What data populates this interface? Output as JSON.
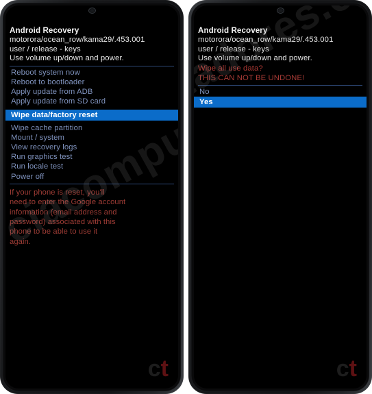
{
  "meta": {
    "scene": "Two Android phones side by side showing stock Android Recovery mode",
    "accent_highlight": "#0b6cc9",
    "menu_text_color": "#7f92bd",
    "warning_color": "#b23b36",
    "divider_color": "#2e4a7a"
  },
  "watermarks": {
    "diagonal_text": "ciacomputadores.com",
    "logo_c": "c",
    "logo_t": "t"
  },
  "phones": {
    "left": {
      "header": {
        "title": "Android Recovery",
        "build": "motorora/ocean_row/kama29/.453.001",
        "release": "user / release - keys",
        "instructions": "Use volume up/down and power."
      },
      "menu": {
        "group_one": [
          {
            "label": "Reboot system now",
            "selected": false
          },
          {
            "label": "Reboot to bootloader",
            "selected": false
          },
          {
            "label": "Apply update from ADB",
            "selected": false
          },
          {
            "label": "Apply update from SD card",
            "selected": false
          }
        ],
        "highlighted": {
          "label": "Wipe data/factory reset",
          "selected": true
        },
        "group_two": [
          {
            "label": "Wipe cache partition",
            "selected": false
          },
          {
            "label": "Mount / system",
            "selected": false
          },
          {
            "label": "View recovery logs",
            "selected": false
          },
          {
            "label": "Run graphics test",
            "selected": false
          },
          {
            "label": "Run locale test",
            "selected": false
          },
          {
            "label": "Power off",
            "selected": false
          }
        ]
      },
      "note_lines": [
        "If your phone is reset, you'll",
        "need to enter the Google account",
        "information (email address and",
        "password) associated with this",
        "phone to be able to use it",
        "again."
      ]
    },
    "right": {
      "header": {
        "title": "Android Recovery",
        "build": "motorora/ocean_row/kama29/.453.001",
        "release": "user / release - keys",
        "instructions": "Use volume up/down and power."
      },
      "confirm": {
        "question": "Wipe all use data?",
        "caution": "THIS CAN NOT BE UNDONE!"
      },
      "options": [
        {
          "label": "No",
          "selected": false
        },
        {
          "label": "Yes",
          "selected": true
        }
      ]
    }
  }
}
